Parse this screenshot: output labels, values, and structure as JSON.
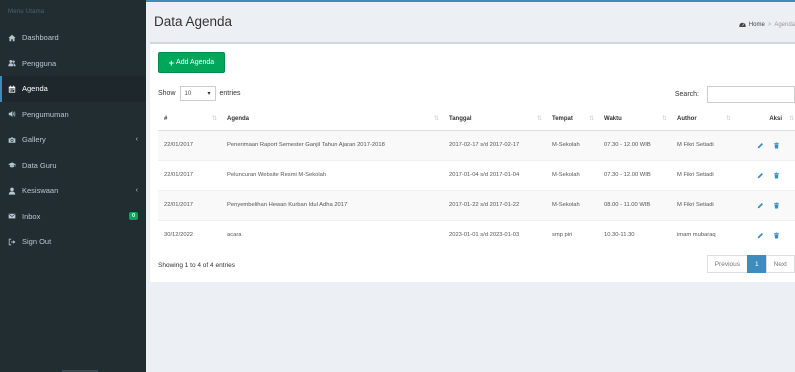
{
  "sidebar": {
    "header": "Menu Utama",
    "items": [
      {
        "label": "Dashboard",
        "icon": "home-icon"
      },
      {
        "label": "Pengguna",
        "icon": "users-icon"
      },
      {
        "label": "Agenda",
        "icon": "calendar-icon"
      },
      {
        "label": "Pengumuman",
        "icon": "volume-icon"
      },
      {
        "label": "Gallery",
        "icon": "camera-icon"
      },
      {
        "label": "Data Guru",
        "icon": "graduation-cap-icon"
      },
      {
        "label": "Kesiswaan",
        "icon": "user-icon"
      },
      {
        "label": "Inbox",
        "icon": "envelope-icon",
        "badge": "0"
      },
      {
        "label": "Sign Out",
        "icon": "sign-out-icon"
      }
    ]
  },
  "header": {
    "title": "Data Agenda",
    "breadcrumb_home": "Home",
    "breadcrumb_current": "Agenda"
  },
  "toolbar": {
    "add_label": "Add Agenda"
  },
  "table_controls": {
    "show_label": "Show",
    "length_value": "10",
    "entries_label": "entries",
    "search_label": "Search:"
  },
  "table": {
    "columns": [
      "#",
      "Agenda",
      "Tanggal",
      "Tempat",
      "Waktu",
      "Author",
      "Aksi"
    ],
    "rows": [
      [
        "22/01/2017",
        "Penerimaan Raport Semester Ganjil Tahun Ajaran 2017-2018",
        "2017-02-17 s/d 2017-02-17",
        "M-Sekolah",
        "07.30 - 12.00 WIB",
        "M Fikri Setiadi"
      ],
      [
        "22/01/2017",
        "Peluncuran Website Resmi M-Sekolah",
        "2017-01-04 s/d 2017-01-04",
        "M-Sekolah",
        "07.30 - 12.00 WIB",
        "M Fikri Setiadi"
      ],
      [
        "22/01/2017",
        "Penyembelihan Hewan Kurban Idul Adha 2017",
        "2017-01-22 s/d 2017-01-22",
        "M-Sekolah",
        "08.00 - 11.00 WIB",
        "M Fikri Setiadi"
      ],
      [
        "30/12/2022",
        "acara",
        "2023-01-01 s/d 2023-01-03",
        "smp piri",
        "10.30-11.30",
        "imam mubaraq"
      ]
    ]
  },
  "footer": {
    "info": "Showing 1 to 4 of 4 entries",
    "previous": "Previous",
    "page": "1",
    "next": "Next"
  },
  "colors": {
    "sidebar_bg": "#222d32",
    "accent": "#3c8dbc",
    "add_button": "#00a65a"
  }
}
